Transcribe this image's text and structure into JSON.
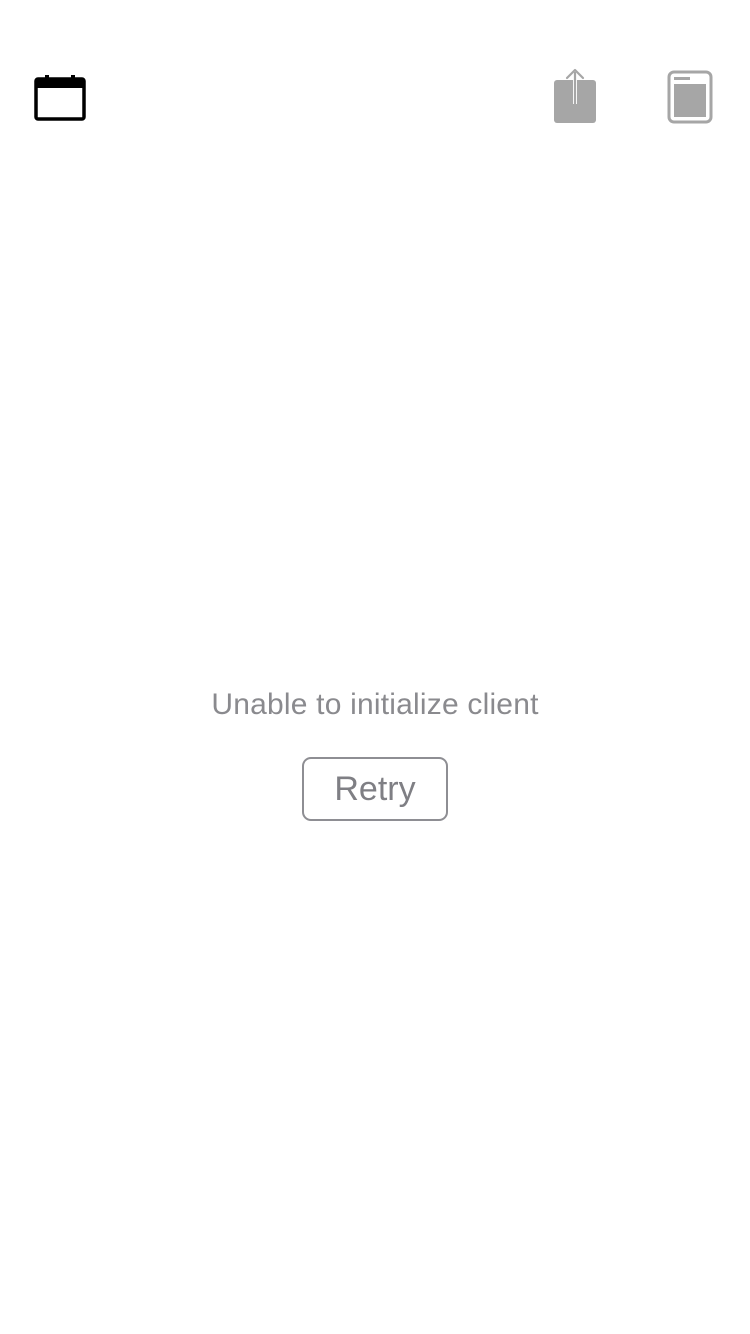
{
  "toolbar": {
    "left_icon": "calendar-icon",
    "right_icons": [
      "share-icon",
      "reader-icon"
    ],
    "icon_color_active": "#000000",
    "icon_color_disabled": "#a6a6a6"
  },
  "main": {
    "error_message": "Unable to initialize client",
    "retry_label": "Retry"
  },
  "colors": {
    "text_secondary": "#8a8a8e",
    "button_border": "#8e8e93",
    "background": "#ffffff"
  }
}
